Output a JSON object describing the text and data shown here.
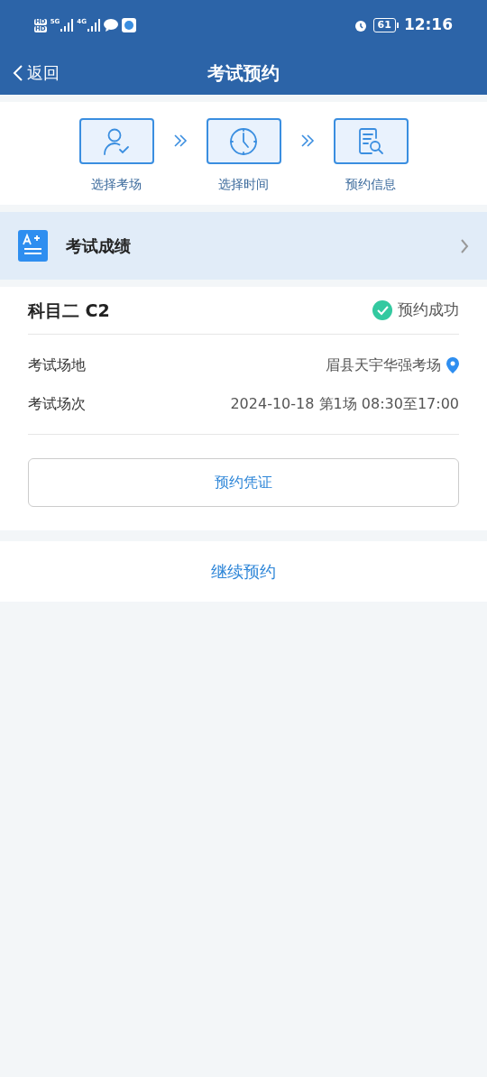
{
  "status_bar": {
    "sim_badges": [
      "HD",
      "HD"
    ],
    "networks": [
      "5G",
      "4G"
    ],
    "battery": "61",
    "time": "12:16"
  },
  "nav": {
    "back": "返回",
    "title": "考试预约"
  },
  "steps": [
    {
      "kind": "venue",
      "label": "选择考场"
    },
    {
      "kind": "time",
      "label": "选择时间"
    },
    {
      "kind": "info",
      "label": "预约信息"
    }
  ],
  "score_link": {
    "label": "考试成绩"
  },
  "booking": {
    "subject": "科目二 C2",
    "status": "预约成功",
    "success": true,
    "fields": [
      {
        "label": "考试场地",
        "value": "眉县天宇华强考场",
        "kind": "location"
      },
      {
        "label": "考试场次",
        "value": "2024-10-18 第1场 08:30至17:00",
        "kind": "plain"
      }
    ],
    "voucher_button": "预约凭证"
  },
  "continue_button": "继续预约"
}
